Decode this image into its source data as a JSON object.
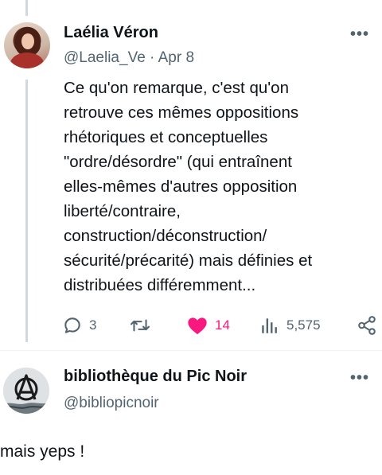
{
  "tweet": {
    "author_name": "Laélia Véron",
    "handle_date": "@Laelia_Ve · Apr 8",
    "text_lines": [
      "Ce qu'on remarque, c'est qu'on",
      "retrouve ces mêmes oppositions",
      "rhétoriques et conceptuelles",
      "\"ordre/désordre\" (qui entraînent",
      "elles-mêmes d'autres opposition",
      "liberté/contraire,",
      "construction/déconstruction/",
      "sécurité/précarité) mais définies et",
      "distribuées différemment..."
    ],
    "replies": "3",
    "likes": "14",
    "views": "5,575",
    "more_label": "•••"
  },
  "reply": {
    "author_name": "bibliothèque du Pic Noir",
    "handle": "@bibliopicnoir",
    "more_label": "•••",
    "text": "mais yeps !"
  },
  "colors": {
    "like": "#f91880",
    "secondary": "#536471",
    "line": "#cfd9de"
  },
  "icons": [
    "reply-icon",
    "retweet-icon",
    "heart-icon",
    "views-icon",
    "share-icon",
    "more-icon"
  ]
}
